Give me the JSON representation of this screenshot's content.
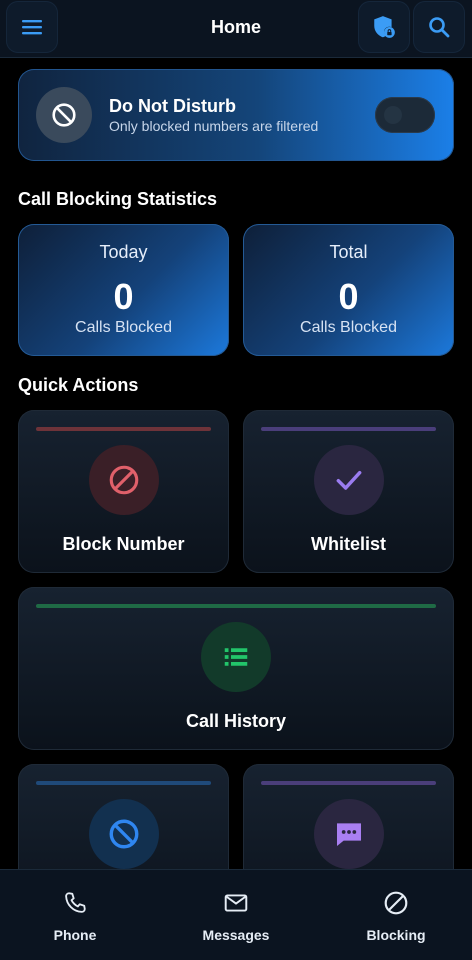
{
  "header": {
    "title": "Home"
  },
  "dnd": {
    "title": "Do Not Disturb",
    "subtitle": "Only blocked numbers are filtered",
    "enabled": false
  },
  "stats": {
    "section_title": "Call Blocking Statistics",
    "items": [
      {
        "label": "Today",
        "value": "0",
        "sub": "Calls Blocked"
      },
      {
        "label": "Total",
        "value": "0",
        "sub": "Calls Blocked"
      }
    ]
  },
  "quick_actions": {
    "section_title": "Quick Actions",
    "items": [
      {
        "label": "Block Number",
        "icon": "block-icon",
        "color": "#e0606a"
      },
      {
        "label": "Whitelist",
        "icon": "check-icon",
        "color": "#9a7cf0"
      },
      {
        "label": "Call History",
        "icon": "list-icon",
        "color": "#22c56a"
      },
      {
        "label": "",
        "icon": "block-icon",
        "color": "#2f86f0"
      },
      {
        "label": "",
        "icon": "message-icon",
        "color": "#a97ff2"
      }
    ]
  },
  "bottom_nav": {
    "items": [
      {
        "label": "Phone",
        "icon": "phone-icon"
      },
      {
        "label": "Messages",
        "icon": "mail-icon"
      },
      {
        "label": "Blocking",
        "icon": "block-icon"
      }
    ]
  },
  "colors": {
    "accent": "#1b7fe8",
    "background": "#000000",
    "surface": "#0b1420"
  }
}
